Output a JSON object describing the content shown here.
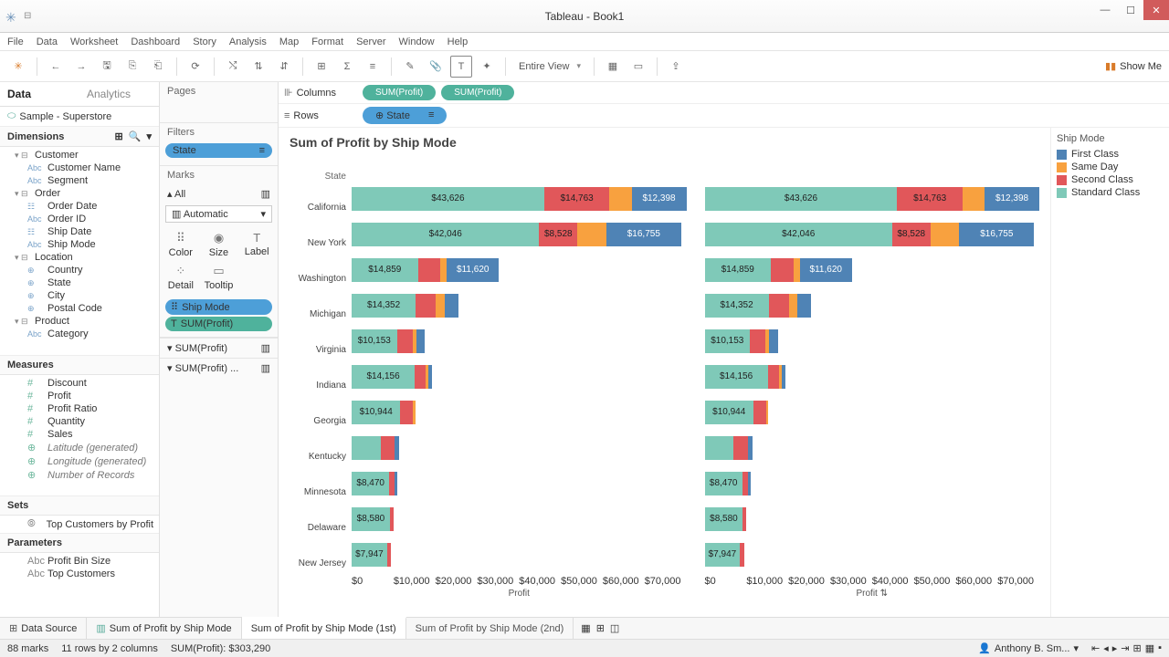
{
  "window": {
    "title": "Tableau - Book1"
  },
  "menu": [
    "File",
    "Data",
    "Worksheet",
    "Dashboard",
    "Story",
    "Analysis",
    "Map",
    "Format",
    "Server",
    "Window",
    "Help"
  ],
  "toolbar": {
    "fit": "Entire View",
    "showme": "Show Me"
  },
  "side": {
    "tabs": {
      "data": "Data",
      "analytics": "Analytics"
    },
    "datasource": "Sample - Superstore",
    "dim_header": "Dimensions",
    "meas_header": "Measures",
    "sets_header": "Sets",
    "params_header": "Parameters",
    "dims": [
      {
        "t": "folder",
        "l": "Customer",
        "lvl": 1
      },
      {
        "t": "abc",
        "l": "Customer Name",
        "lvl": 2
      },
      {
        "t": "abc",
        "l": "Segment",
        "lvl": 2
      },
      {
        "t": "folder",
        "l": "Order",
        "lvl": 1
      },
      {
        "t": "date",
        "l": "Order Date",
        "lvl": 2
      },
      {
        "t": "abc",
        "l": "Order ID",
        "lvl": 2
      },
      {
        "t": "date",
        "l": "Ship Date",
        "lvl": 2
      },
      {
        "t": "abc",
        "l": "Ship Mode",
        "lvl": 2
      },
      {
        "t": "folder",
        "l": "Location",
        "lvl": 1
      },
      {
        "t": "geo",
        "l": "Country",
        "lvl": 2
      },
      {
        "t": "geo",
        "l": "State",
        "lvl": 2
      },
      {
        "t": "geo",
        "l": "City",
        "lvl": 2
      },
      {
        "t": "geo",
        "l": "Postal Code",
        "lvl": 2
      },
      {
        "t": "folder",
        "l": "Product",
        "lvl": 1
      },
      {
        "t": "abc",
        "l": "Category",
        "lvl": 2
      }
    ],
    "meas": [
      {
        "l": "Discount"
      },
      {
        "l": "Profit"
      },
      {
        "l": "Profit Ratio"
      },
      {
        "l": "Quantity"
      },
      {
        "l": "Sales"
      },
      {
        "l": "Latitude (generated)",
        "gen": true
      },
      {
        "l": "Longitude (generated)",
        "gen": true
      },
      {
        "l": "Number of Records",
        "gen": true
      }
    ],
    "sets": [
      {
        "l": "Top Customers by Profit"
      }
    ],
    "params": [
      {
        "l": "Profit Bin Size"
      },
      {
        "l": "Top Customers"
      }
    ]
  },
  "mid": {
    "pages": "Pages",
    "filters": "Filters",
    "filter_pill": "State",
    "marks": "Marks",
    "all": "All",
    "marktype": "Automatic",
    "cells": [
      "Color",
      "Size",
      "Label",
      "Detail",
      "Tooltip"
    ],
    "shipmode": "Ship Mode",
    "sumprofit": "SUM(Profit)",
    "sum1": "SUM(Profit)",
    "sum2": "SUM(Profit) ..."
  },
  "shelves": {
    "columns": "Columns",
    "rows": "Rows",
    "col_pills": [
      "SUM(Profit)",
      "SUM(Profit)"
    ],
    "row_pill": "State"
  },
  "viz": {
    "title": "Sum of Profit by Ship Mode",
    "state_hdr": "State",
    "axis_label": "Profit",
    "axis_label2": "Profit ⇅",
    "ticks": [
      "$0",
      "$10,000",
      "$20,000",
      "$30,000",
      "$40,000",
      "$50,000",
      "$60,000",
      "$70,000"
    ]
  },
  "legend": {
    "title": "Ship Mode",
    "items": [
      {
        "l": "First Class",
        "c": "#4f83b5"
      },
      {
        "l": "Same Day",
        "c": "#f8a13f"
      },
      {
        "l": "Second Class",
        "c": "#e1575a"
      },
      {
        "l": "Standard Class",
        "c": "#7fc9b8"
      }
    ]
  },
  "chart_data": {
    "type": "bar",
    "xlabel": "Profit",
    "ylabel": "State",
    "xlim": [
      0,
      75000
    ],
    "series_order": [
      "Standard Class",
      "Second Class",
      "Same Day",
      "First Class"
    ],
    "rows": [
      {
        "state": "California",
        "std": {
          "v": 43626,
          "l": "$43,626"
        },
        "sec": {
          "v": 14763,
          "l": "$14,763"
        },
        "same": {
          "v": 5000,
          "l": ""
        },
        "first": {
          "v": 12398,
          "l": "$12,398"
        }
      },
      {
        "state": "New York",
        "std": {
          "v": 42046,
          "l": "$42,046"
        },
        "sec": {
          "v": 8528,
          "l": "$8,528"
        },
        "same": {
          "v": 6500,
          "l": ""
        },
        "first": {
          "v": 16755,
          "l": "$16,755"
        }
      },
      {
        "state": "Washington",
        "std": {
          "v": 14859,
          "l": "$14,859"
        },
        "sec": {
          "v": 5000,
          "l": ""
        },
        "same": {
          "v": 1500,
          "l": ""
        },
        "first": {
          "v": 11620,
          "l": "$11,620"
        }
      },
      {
        "state": "Michigan",
        "std": {
          "v": 14352,
          "l": "$14,352"
        },
        "sec": {
          "v": 4500,
          "l": ""
        },
        "same": {
          "v": 2000,
          "l": ""
        },
        "first": {
          "v": 3000,
          "l": ""
        }
      },
      {
        "state": "Virginia",
        "std": {
          "v": 10153,
          "l": "$10,153"
        },
        "sec": {
          "v": 3500,
          "l": ""
        },
        "same": {
          "v": 800,
          "l": ""
        },
        "first": {
          "v": 2000,
          "l": ""
        }
      },
      {
        "state": "Indiana",
        "std": {
          "v": 14156,
          "l": "$14,156"
        },
        "sec": {
          "v": 2500,
          "l": ""
        },
        "same": {
          "v": 600,
          "l": ""
        },
        "first": {
          "v": 800,
          "l": ""
        }
      },
      {
        "state": "Georgia",
        "std": {
          "v": 10944,
          "l": "$10,944"
        },
        "sec": {
          "v": 2800,
          "l": ""
        },
        "same": {
          "v": 500,
          "l": ""
        },
        "first": {
          "v": 0,
          "l": ""
        }
      },
      {
        "state": "Kentucky",
        "std": {
          "v": 6500,
          "l": ""
        },
        "sec": {
          "v": 3200,
          "l": ""
        },
        "same": {
          "v": 0,
          "l": ""
        },
        "first": {
          "v": 1000,
          "l": ""
        }
      },
      {
        "state": "Minnesota",
        "std": {
          "v": 8470,
          "l": "$8,470"
        },
        "sec": {
          "v": 1200,
          "l": ""
        },
        "same": {
          "v": 0,
          "l": ""
        },
        "first": {
          "v": 600,
          "l": ""
        }
      },
      {
        "state": "Delaware",
        "std": {
          "v": 8580,
          "l": "$8,580"
        },
        "sec": {
          "v": 800,
          "l": ""
        },
        "same": {
          "v": 0,
          "l": ""
        },
        "first": {
          "v": 0,
          "l": ""
        }
      },
      {
        "state": "New Jersey",
        "std": {
          "v": 7947,
          "l": "$7,947"
        },
        "sec": {
          "v": 900,
          "l": ""
        },
        "same": {
          "v": 0,
          "l": ""
        },
        "first": {
          "v": 0,
          "l": ""
        }
      }
    ]
  },
  "tabs": {
    "ds": "Data Source",
    "s1": "Sum of Profit by Ship Mode",
    "s2": "Sum of Profit by Ship Mode (1st)",
    "s3": "Sum of Profit by Ship Mode (2nd)"
  },
  "status": {
    "marks": "88 marks",
    "rows": "11 rows by 2 columns",
    "sum": "SUM(Profit): $303,290",
    "user": "Anthony B. Sm..."
  }
}
